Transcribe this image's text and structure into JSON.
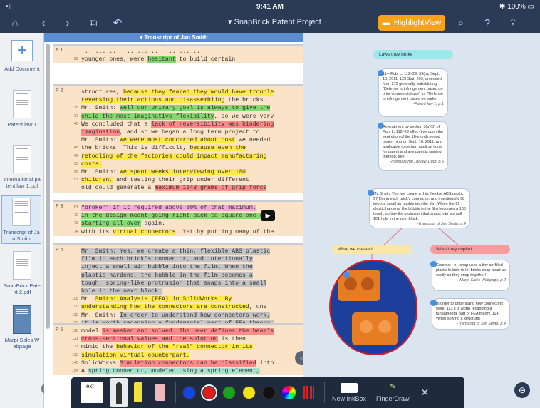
{
  "status": {
    "time": "9:41 AM",
    "battery": "100%",
    "signal": "•ıl"
  },
  "toolbar": {
    "project_title": "SnapBrick Patent Project",
    "highlight_label": "HighlightView"
  },
  "sidebar": {
    "add_label": "Add Document",
    "items": [
      {
        "label": "Patent law 1"
      },
      {
        "label": "International pa tent law 1.pdf"
      },
      {
        "label": "Transcript of Ja n Smith"
      },
      {
        "label": "SnapBrick Pate nt 2.pdf"
      },
      {
        "label": "Marpi Sales W ebpage"
      }
    ]
  },
  "document": {
    "title": "Transcript of Jan Smith",
    "paragraphs": [
      {
        "label": "P 1",
        "lines": [
          {
            "n": "",
            "parts": [
              {
                "t": "... ... ... ... ... ... ... ... ...",
                "h": ""
              }
            ]
          },
          {
            "n": "29",
            "parts": [
              {
                "t": "younger ones, were ",
                "h": ""
              },
              {
                "t": "hesitant",
                "h": "g"
              },
              {
                "t": " to build certain",
                "h": ""
              }
            ]
          }
        ]
      },
      {
        "label": "P 2",
        "lines": [
          {
            "n": "",
            "parts": [
              {
                "t": "structures, ",
                "h": ""
              },
              {
                "t": "because they feared they would have trouble",
                "h": "y"
              }
            ]
          },
          {
            "n": "",
            "parts": [
              {
                "t": "reversing their actions and disassembling",
                "h": "y"
              },
              {
                "t": " the bricks.",
                "h": ""
              }
            ]
          },
          {
            "n": "36",
            "parts": [
              {
                "t": "Mr. Smith: ",
                "h": ""
              },
              {
                "t": "Well our primary goal is always to give the",
                "h": "g"
              }
            ]
          },
          {
            "n": "37",
            "parts": [
              {
                "t": "child the most imaginative flexibility",
                "h": "g"
              },
              {
                "t": ", so we were very",
                "h": ""
              }
            ]
          },
          {
            "n": "40",
            "parts": [
              {
                "t": "We concluded that a ",
                "h": ""
              },
              {
                "t": "lack of reversibility was hindering",
                "h": "r"
              }
            ]
          },
          {
            "n": "",
            "parts": [
              {
                "t": "imagination",
                "h": "r"
              },
              {
                "t": ", and so we began a long term project to",
                "h": ""
              }
            ]
          },
          {
            "n": "",
            "parts": [
              {
                "t": "Mr. Smith: ",
                "h": ""
              },
              {
                "t": "We were most concerned about cost",
                "h": "y"
              },
              {
                "t": " we needed",
                "h": ""
              }
            ]
          },
          {
            "n": "48",
            "parts": [
              {
                "t": "the bricks. This is difficult, ",
                "h": ""
              },
              {
                "t": "because even the",
                "h": "y"
              }
            ]
          },
          {
            "n": "49",
            "parts": [
              {
                "t": "retooling of the factories could impact manufacturing",
                "h": "y"
              }
            ]
          },
          {
            "n": "50",
            "parts": [
              {
                "t": "costs.",
                "h": "y"
              }
            ]
          },
          {
            "n": "56",
            "parts": [
              {
                "t": "Mr. Smith: ",
                "h": ""
              },
              {
                "t": "We spent weeks interviewing over 100",
                "h": "y"
              }
            ]
          },
          {
            "n": "57",
            "parts": [
              {
                "t": "children,",
                "h": "y"
              },
              {
                "t": " and testing their grip under different",
                "h": ""
              }
            ]
          },
          {
            "n": "",
            "parts": [
              {
                "t": "old could generate a ",
                "h": ""
              },
              {
                "t": "maximum 1143 grams of grip force",
                "h": "r"
              }
            ]
          }
        ]
      },
      {
        "label": "P 3",
        "lines": [
          {
            "n": "61",
            "parts": [
              {
                "t": "\"broken\" if it required above 80% of that maximum.",
                "h": "p"
              }
            ]
          },
          {
            "n": "72",
            "parts": [
              {
                "t": "in the design meant going right back to square one and",
                "h": "g"
              }
            ]
          },
          {
            "n": "73",
            "parts": [
              {
                "t": "starting all over",
                "h": "g"
              },
              {
                "t": " again.",
                "h": ""
              }
            ]
          },
          {
            "n": "74",
            "parts": [
              {
                "t": "with its ",
                "h": ""
              },
              {
                "t": "virtual connectors",
                "h": "y"
              },
              {
                "t": ". Yet by putting many of the",
                "h": ""
              }
            ]
          }
        ]
      },
      {
        "label": "P 4",
        "lines": [
          {
            "n": "",
            "parts": [
              {
                "t": "Mr. Smith: Yes, we create a thin, flexible ABS plastic",
                "h": "gr"
              }
            ]
          },
          {
            "n": "",
            "parts": [
              {
                "t": "film in each brick's connector, and intentionally",
                "h": "gr"
              }
            ]
          },
          {
            "n": "",
            "parts": [
              {
                "t": "inject a small air bubble into the film. When the",
                "h": "gr"
              }
            ]
          },
          {
            "n": "",
            "parts": [
              {
                "t": "plastic hardens, the bubble in the film becomes a",
                "h": "gr"
              }
            ]
          },
          {
            "n": "",
            "parts": [
              {
                "t": "tough, spring-like protrusion that snaps into a small",
                "h": "gr"
              }
            ]
          },
          {
            "n": "",
            "parts": [
              {
                "t": "hole in the next block.",
                "h": "gr"
              }
            ]
          },
          {
            "n": "108",
            "parts": [
              {
                "t": "Mr. ",
                "h": ""
              },
              {
                "t": "Smith: Analysis (FEA) in SolidWorks. By",
                "h": "y"
              }
            ]
          },
          {
            "n": "109",
            "parts": [
              {
                "t": "understanding how the connectors are constructed",
                "h": "y"
              },
              {
                "t": ", one",
                "h": ""
              }
            ]
          },
          {
            "n": "112",
            "parts": [
              {
                "t": "Mr. Smith: ",
                "h": ""
              },
              {
                "t": "In order to understand how connectors work,",
                "h": "gr"
              }
            ]
          },
          {
            "n": "113",
            "parts": [
              {
                "t": "it is worth recapping a fundamental part of FEA theory.",
                "h": "gr"
              }
            ]
          },
          {
            "n": "114",
            "parts": [
              {
                "t": "When solving a structural ",
                "h": "gr"
              },
              {
                "t": "problem, the system breaks",
                "h": ""
              }
            ]
          }
        ]
      },
      {
        "label": "P 5",
        "lines": [
          {
            "n": "120",
            "parts": [
              {
                "t": "model ",
                "h": ""
              },
              {
                "t": "is meshed and solved. The user defines the beam's",
                "h": "r"
              }
            ]
          },
          {
            "n": "121",
            "parts": [
              {
                "t": "cross-sectional values and the solution",
                "h": "r"
              },
              {
                "t": " is then",
                "h": ""
              }
            ]
          },
          {
            "n": "131",
            "parts": [
              {
                "t": "mimic the ",
                "h": ""
              },
              {
                "t": "behavior of the \"real\" connector in its",
                "h": "y"
              }
            ]
          },
          {
            "n": "132",
            "parts": [
              {
                "t": "simulation virtual counterpart.",
                "h": "y"
              }
            ]
          },
          {
            "n": "143",
            "parts": [
              {
                "t": "SolidWorks ",
                "h": ""
              },
              {
                "t": "Simulation connectors can be classified",
                "h": "r"
              },
              {
                "t": " into",
                "h": ""
              }
            ]
          },
          {
            "n": "154",
            "parts": [
              {
                "t": "A ",
                "h": ""
              },
              {
                "t": "spring connector, modeled using a spring element,",
                "h": "c"
              }
            ]
          }
        ]
      }
    ]
  },
  "canvas": {
    "laws_title": "Laws they broke",
    "law1_text": "11—Pub. L. 112–29, §9(b), Sept. 16, 2011, 125 Stat. 299, amended form 273 generally, substituting \"Defense to infringement based on prior commercial use\" for \"Defense to infringement based on earlie",
    "law1_src": "-Patent law 1, p.1",
    "law2_text": "Amendment by section 3(g)(5) of Pub. L. 112–29 effec- tive upon the expiration of the 18-month period begin- ning on Sept. 16, 2011, and applicable to certain applica- tions for patent and any patents issuing thereon, see",
    "law2_src": "-International...nt law 1.pdf, p.5",
    "quote_text": "Mr. Smith: Yes, we create a thin, flexible ABS plastic 97 film in each brick's connector, and intentionally 98 inject a small air bubble into the film. When the 99 plastic hardens, the bubble in the film becomes a 100 tough, spring-like protrusion that snaps into a small 101 hole in the next block.",
    "quote_src": "-Transcript of Jan Smith, p.4",
    "created_label": "What we created",
    "copied_label": "What they copied",
    "copy1_text": "Connect - o - snap uses a tiny air-filled plastic bubble to let bricks snap apart as easily as they snap together!",
    "copy1_src": "-Marpi Sales Webpage, p.2",
    "copy2_text": "In order to understand how connectors work, 113 it is worth recapping a fundamental part of FEA theory. 114 When solving a structural",
    "copy2_src": "-Transcript of Jan Smith, p.4"
  },
  "drawbar": {
    "text_tool": "Text",
    "new_inkbox": "New InkBox",
    "fingerdraw": "FingerDraw",
    "colors": [
      "#1646e0",
      "#e21c1c",
      "#1aa31a",
      "#f2e21a",
      "#111111"
    ]
  }
}
